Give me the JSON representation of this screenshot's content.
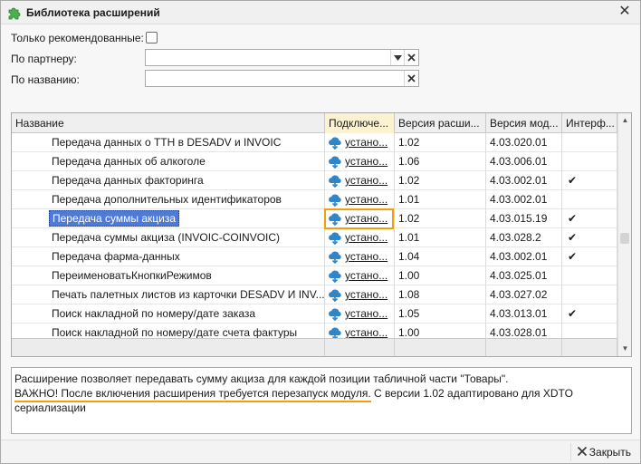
{
  "window": {
    "title": "Библиотека расширений",
    "close_symbol": "✕"
  },
  "filters": {
    "recommended_label": "Только рекомендованные:",
    "recommended_checked": false,
    "partner_label": "По партнеру:",
    "partner_value": "",
    "name_label": "По названию:",
    "name_value": ""
  },
  "table": {
    "headers": {
      "name": "Название",
      "plug": "Подключе...",
      "ext_version": "Версия расши...",
      "module_version": "Версия мод...",
      "interface": "Интерф..."
    },
    "rows": [
      {
        "name": "Передача данных о ТТН в DESADV и INVOIC",
        "plug": "устано...",
        "ext_version": "1.02",
        "module_version": "4.03.020.01",
        "interface": ""
      },
      {
        "name": "Передача данных об алкоголе",
        "plug": "устано...",
        "ext_version": "1.06",
        "module_version": "4.03.006.01",
        "interface": ""
      },
      {
        "name": "Передача данных факторинга",
        "plug": "устано...",
        "ext_version": "1.02",
        "module_version": "4.03.002.01",
        "interface": "✔"
      },
      {
        "name": "Передача дополнительных идентификаторов",
        "plug": "устано...",
        "ext_version": "1.01",
        "module_version": "4.03.002.01",
        "interface": ""
      },
      {
        "name": "Передача суммы акциза",
        "plug": "устано...",
        "ext_version": "1.02",
        "module_version": "4.03.015.19",
        "interface": "✔"
      },
      {
        "name": "Передача суммы акциза (INVOIC-COINVOIC)",
        "plug": "устано...",
        "ext_version": "1.01",
        "module_version": "4.03.028.2",
        "interface": "✔"
      },
      {
        "name": "Передача фарма-данных",
        "plug": "устано...",
        "ext_version": "1.04",
        "module_version": "4.03.002.01",
        "interface": "✔"
      },
      {
        "name": "ПереименоватьКнопкиРежимов",
        "plug": "устано...",
        "ext_version": "1.00",
        "module_version": "4.03.025.01",
        "interface": ""
      },
      {
        "name": "Печать палетных листов из карточки DESADV И INV...",
        "plug": "устано...",
        "ext_version": "1.08",
        "module_version": "4.03.027.02",
        "interface": ""
      },
      {
        "name": "Поиск накладной по номеру/дате заказа",
        "plug": "устано...",
        "ext_version": "1.05",
        "module_version": "4.03.013.01",
        "interface": "✔"
      },
      {
        "name": "Поиск накладной по номеру/дате счета фактуры",
        "plug": "устано...",
        "ext_version": "1.00",
        "module_version": "4.03.028.01",
        "interface": ""
      }
    ],
    "selected_row": 4
  },
  "description": {
    "line1": "Расширение позволяет передавать сумму акциза для каждой позиции табличной части \"Товары\".",
    "line2_warning": "ВАЖНО! После включения расширения требуется перезапуск модуля.",
    "line2_rest": " С версии 1.02 адаптировано для XDTO",
    "line3": "сериализации"
  },
  "footer": {
    "close_label": "Закрыть"
  },
  "colors": {
    "accent_orange": "#f39c12",
    "selection_blue": "#4f7bd7",
    "cloud_blue": "#2f86c8",
    "title_icon_green": "#4caf50"
  },
  "icons": {
    "title": "puzzle-icon",
    "cloud": "cloud-download-icon",
    "dropdown": "chevron-down-icon",
    "clear": "clear-x-icon",
    "close": "close-x-icon"
  }
}
